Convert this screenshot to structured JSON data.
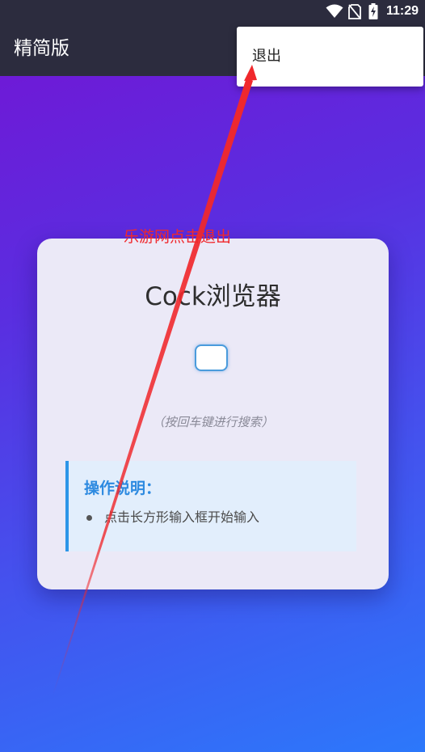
{
  "status_bar": {
    "time": "11:29",
    "icons": [
      "wifi-icon",
      "no-sim-icon",
      "battery-charging-icon"
    ]
  },
  "app_bar": {
    "title": "精简版"
  },
  "overflow_menu": {
    "items": [
      {
        "label": "退出"
      }
    ]
  },
  "card": {
    "title": "Cock浏览器",
    "search": {
      "value": "",
      "placeholder": ""
    },
    "hint": "（按回车键进行搜索）",
    "instructions": {
      "title": "操作说明：",
      "items": [
        "点击长方形输入框开始输入"
      ]
    }
  },
  "annotation": {
    "text": "乐游网点击退出",
    "color": "#f0282c"
  },
  "colors": {
    "topbar": "#2c2c3e",
    "gradient_start": "#7414d4",
    "gradient_end": "#2c78fb",
    "accent_blue": "#2d96e8"
  }
}
